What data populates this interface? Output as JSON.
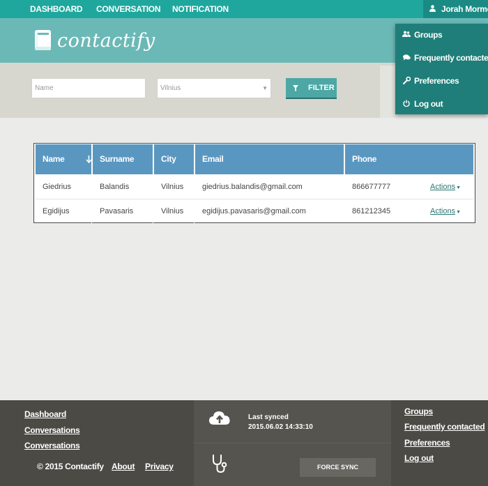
{
  "topnav": {
    "items": [
      "DASHBOARD",
      "CONVERSATION",
      "NOTIFICATION"
    ],
    "user_name": "Jorah Mormonth",
    "colors": {
      "bar": "#1fa79e",
      "user_bg": "#1b8a84"
    }
  },
  "header": {
    "brand": "contactify",
    "logo_icon": "book-icon"
  },
  "filter": {
    "name_placeholder": "Name",
    "city_value": "Vilnius",
    "button_label": "FILTER",
    "button_icon": "filter-icon"
  },
  "menu": {
    "items": [
      {
        "label": "Groups",
        "icon": "users-icon"
      },
      {
        "label": "Frequently contacted",
        "icon": "comments-icon"
      },
      {
        "label": "Preferences",
        "icon": "wrench-icon"
      },
      {
        "label": "Log out",
        "icon": "power-icon"
      }
    ]
  },
  "table": {
    "headers": [
      "Name",
      "Surname",
      "City",
      "Email",
      "Phone"
    ],
    "sort_icon": "arrow-down-icon",
    "rows": [
      {
        "name": "Giedrius",
        "surname": "Balandis",
        "city": "Vilnius",
        "email": "giedrius.balandis@gmail.com",
        "phone": "866677777",
        "actions": "Actions"
      },
      {
        "name": "Egidijus",
        "surname": "Pavasaris",
        "city": "Vilnius",
        "email": "egidijus.pavasaris@gmail.com",
        "phone": "861212345",
        "actions": "Actions"
      }
    ],
    "header_color": "#5a97c0"
  },
  "footer": {
    "left_links": [
      "Dashboard",
      "Conversations",
      "Conversations"
    ],
    "copyright": "© 2015 Contactify",
    "about": "About",
    "privacy": "Privacy",
    "sync_label": "Last synced",
    "sync_time": "2015.06.02 14:33:10",
    "sync_icon": "cloud-upload-icon",
    "health_icon": "stethoscope-icon",
    "force_sync": "FORCE SYNC",
    "right_links": [
      "Groups",
      "Frequently contacted",
      "Preferences",
      "Log out"
    ]
  }
}
